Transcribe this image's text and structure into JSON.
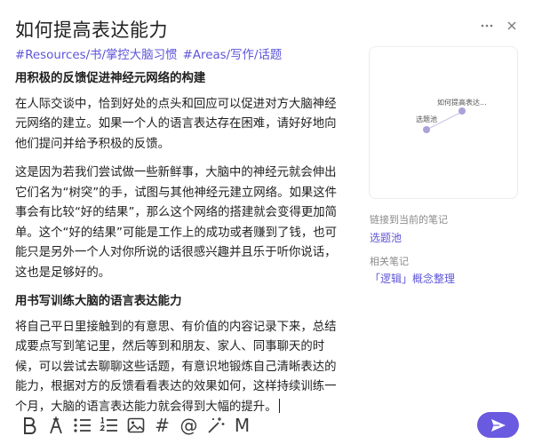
{
  "note": {
    "title": "如何提高表达能力",
    "tags": [
      "#Resources/书/掌控大脑习惯",
      "#Areas/写作/话题"
    ],
    "heading1": "用积极的反馈促进神经元网络的构建",
    "para1": "在人际交谈中，恰到好处的点头和回应可以促进对方大脑神经元网络的建立。如果一个人的语言表达存在困难，请好好地向他们提问并给予积极的反馈。",
    "para2": "这是因为若我们尝试做一些新鲜事，大脑中的神经元就会伸出它们名为“树突”的手，试图与其他神经元建立网络。如果这件事会有比较“好的结果”，那么这个网络的搭建就会变得更加简单。这个“好的结果”可能是工作上的成功或者赚到了钱，也可能只是另外一个人对你所说的话很感兴趣并且乐于听你说话，这也是足够好的。",
    "heading2": "用书写训练大脑的语言表达能力",
    "para3": "将自己平日里接触到的有意思、有价值的内容记录下来，总结成要点写到笔记里，然后等到和朋友、家人、同事聊天的时候，可以尝试去聊聊这些话题，有意识地锻炼自己清晰表达的能力，根据对方的反馈看看表达的效果如何，这样持续训练一个月，大脑的语言表达能力就会得到大幅的提升。"
  },
  "graph": {
    "node_current": "如何提高表达...",
    "node_linked": "选题池"
  },
  "sidebar": {
    "linked_label": "链接到当前的笔记",
    "linked_item": "选题池",
    "related_label": "相关笔记",
    "related_item": "「逻辑」概念整理"
  },
  "toolbar": {
    "icons": [
      "bold-icon",
      "highlight-icon",
      "bullet-list-icon",
      "numbered-list-icon",
      "image-icon",
      "hashtag-icon",
      "mention-icon",
      "magic-wand-icon",
      "markdown-icon"
    ],
    "hashtag_glyph": "#",
    "mention_glyph": "@",
    "markdown_glyph": "M"
  },
  "colors": {
    "accent": "#6a5ae0",
    "tag": "#5d55d8",
    "node": "#a9a3d9"
  }
}
